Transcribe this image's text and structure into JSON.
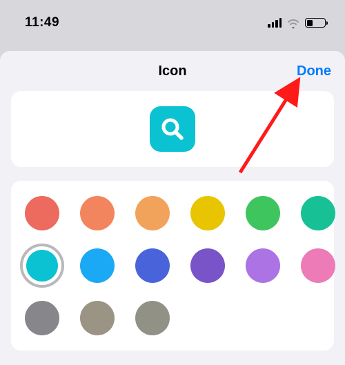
{
  "status": {
    "time": "11:49"
  },
  "sheet": {
    "title": "Icon",
    "done": "Done"
  },
  "preview": {
    "bg": "#0ac2d2",
    "glyph": "magnifying-glass"
  },
  "colors": [
    {
      "hex": "#ec6a5e",
      "sel": false
    },
    {
      "hex": "#f2855d",
      "sel": false
    },
    {
      "hex": "#f2a35b",
      "sel": false
    },
    {
      "hex": "#e8c500",
      "sel": false
    },
    {
      "hex": "#3fc55e",
      "sel": false
    },
    {
      "hex": "#17c195",
      "sel": false
    },
    {
      "hex": "#0ac2d2",
      "sel": true
    },
    {
      "hex": "#1ba8f5",
      "sel": false
    },
    {
      "hex": "#4964db",
      "sel": false
    },
    {
      "hex": "#7953c8",
      "sel": false
    },
    {
      "hex": "#ac73e4",
      "sel": false
    },
    {
      "hex": "#ec7bb7",
      "sel": false
    },
    {
      "hex": "#86868b",
      "sel": false
    },
    {
      "hex": "#9b9484",
      "sel": false
    },
    {
      "hex": "#919186",
      "sel": false
    }
  ],
  "annotation": {
    "arrow_target": "done-button"
  }
}
